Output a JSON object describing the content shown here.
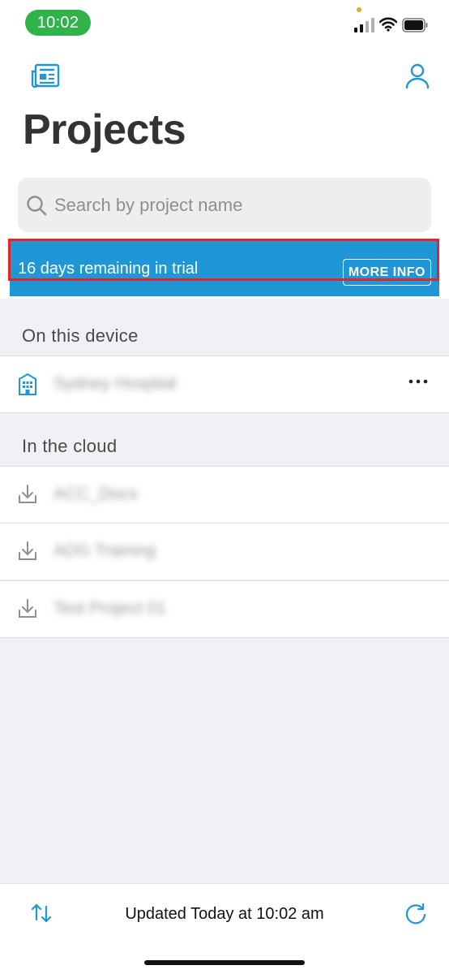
{
  "status_bar": {
    "time": "10:02"
  },
  "header": {
    "title": "Projects"
  },
  "search": {
    "placeholder": "Search by project name"
  },
  "trial": {
    "message": "16 days remaining in trial",
    "button_label": "MORE INFO"
  },
  "sections": {
    "device": {
      "title": "On this device",
      "items": [
        {
          "name": "Sydney Hospital",
          "icon": "building-icon"
        }
      ]
    },
    "cloud": {
      "title": "In the cloud",
      "items": [
        {
          "name": "ACC_Docs",
          "icon": "download-icon"
        },
        {
          "name": "ADG Training",
          "icon": "download-icon"
        },
        {
          "name": "Test Project 01",
          "icon": "download-icon"
        }
      ]
    }
  },
  "footer": {
    "updated_text": "Updated Today at 10:02 am"
  },
  "colors": {
    "accent": "#1f97d6",
    "time_pill": "#30b34a",
    "highlight": "#e3242b"
  }
}
